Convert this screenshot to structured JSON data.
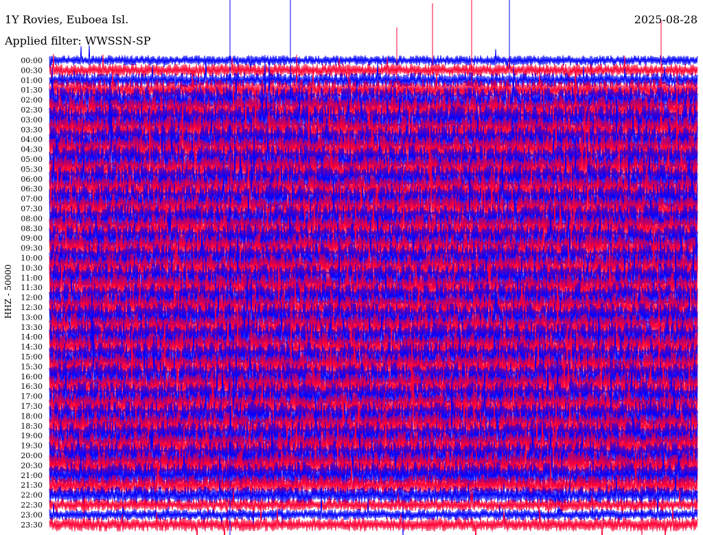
{
  "header": {
    "station": "1Y Rovies, Euboea Isl.",
    "filter": "Applied filter: WWSSN-SP",
    "date": "2025-08-28"
  },
  "chart_data": {
    "type": "line",
    "title": "1Y Rovies, Euboea Isl.",
    "subtitle": "Applied filter: WWSSN-SP",
    "date": "2025-08-28",
    "ylabel": "HHZ - 50000",
    "xlabel": "",
    "y_tick_labels": [
      "00:00",
      "00:30",
      "01:00",
      "01:30",
      "02:00",
      "02:30",
      "03:00",
      "03:30",
      "04:00",
      "04:30",
      "05:00",
      "05:30",
      "06:00",
      "06:30",
      "07:00",
      "07:30",
      "08:00",
      "08:30",
      "09:00",
      "09:30",
      "10:00",
      "10:30",
      "11:00",
      "11:30",
      "12:00",
      "12:30",
      "13:00",
      "13:30",
      "14:00",
      "14:30",
      "15:00",
      "15:30",
      "16:00",
      "16:30",
      "17:00",
      "17:30",
      "18:00",
      "18:30",
      "19:00",
      "19:30",
      "20:00",
      "20:30",
      "21:00",
      "21:30",
      "22:00",
      "22:30",
      "23:00",
      "23:30"
    ],
    "trace_colors": [
      "#0000ff",
      "#ff0033"
    ],
    "trace_amplitude_level": [
      0.25,
      0.35,
      0.45,
      0.7,
      0.9,
      1,
      1,
      1,
      1,
      1,
      1,
      1,
      1,
      1,
      1,
      1,
      1,
      1,
      1,
      1,
      1,
      1,
      1,
      1,
      1,
      1,
      1,
      1,
      1,
      1,
      1,
      1,
      1,
      1,
      1,
      1,
      1,
      1,
      1,
      1,
      1,
      1,
      0.9,
      0.7,
      0.55,
      0.35,
      0.3,
      0.4
    ],
    "grid": false
  }
}
